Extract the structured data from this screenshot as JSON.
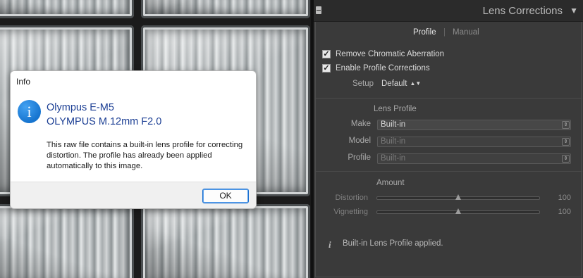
{
  "dialog": {
    "title": "Info",
    "heading_line1": "Olympus E-M5",
    "heading_line2": "OLYMPUS M.12mm F2.0",
    "message": "This raw file contains a built-in lens profile for correcting distortion. The profile has already been applied automatically to this image.",
    "ok_label": "OK",
    "icon": "info-icon",
    "accent_color": "#1a6fd0"
  },
  "panel": {
    "title": "Lens Corrections",
    "collapse_icon": "▼",
    "tabs": [
      {
        "label": "Profile",
        "active": true
      },
      {
        "label": "Manual",
        "active": false
      }
    ],
    "tab_separator": "|",
    "checkboxes": [
      {
        "label": "Remove Chromatic Aberration",
        "checked": true
      },
      {
        "label": "Enable Profile Corrections",
        "checked": true
      }
    ],
    "setup": {
      "label": "Setup",
      "value": "Default"
    },
    "lens_profile": {
      "title": "Lens Profile",
      "fields": [
        {
          "label": "Make",
          "value": "Built-in",
          "enabled": true
        },
        {
          "label": "Model",
          "value": "Built-in",
          "enabled": false
        },
        {
          "label": "Profile",
          "value": "Built-in",
          "enabled": false
        }
      ]
    },
    "amount": {
      "title": "Amount",
      "sliders": [
        {
          "label": "Distortion",
          "value": "100",
          "fraction": 0.5
        },
        {
          "label": "Vignetting",
          "value": "100",
          "fraction": 0.5
        }
      ]
    },
    "status_text": "Built-in Lens Profile applied.",
    "status_icon": "i"
  }
}
